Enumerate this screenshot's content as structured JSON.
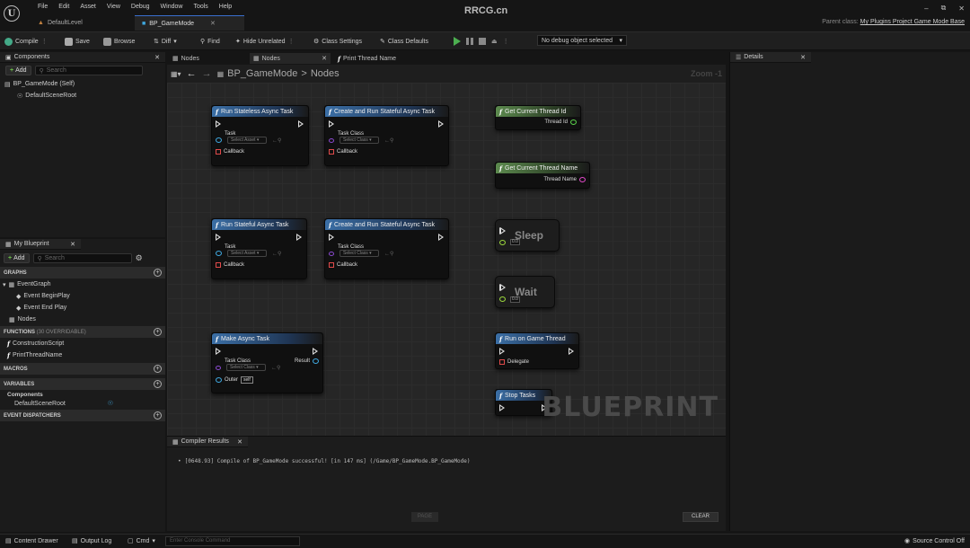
{
  "site_watermark": "RRCG.cn",
  "menu": [
    "File",
    "Edit",
    "Asset",
    "View",
    "Debug",
    "Window",
    "Tools",
    "Help"
  ],
  "tabs": [
    {
      "label": "DefaultLevel",
      "active": false
    },
    {
      "label": "BP_GameMode",
      "active": true
    }
  ],
  "parent_class": {
    "label": "Parent class:",
    "value": "My Plugins Project Game Mode Base"
  },
  "toolbar": {
    "compile": "Compile",
    "save": "Save",
    "browse": "Browse",
    "diff": "Diff",
    "find": "Find",
    "hide_unrelated": "Hide Unrelated",
    "class_settings": "Class Settings",
    "class_defaults": "Class Defaults",
    "debug_object": "No debug object selected"
  },
  "components_panel": {
    "title": "Components",
    "add": "Add",
    "search_placeholder": "Search",
    "root": "BP_GameMode (Self)",
    "child": "DefaultSceneRoot"
  },
  "my_blueprint": {
    "title": "My Blueprint",
    "add": "Add",
    "search_placeholder": "Search",
    "graphs_label": "GRAPHS",
    "event_graph": "EventGraph",
    "begin_play": "Event BeginPlay",
    "end_play": "Event End Play",
    "nodes_graph": "Nodes",
    "functions_label": "FUNCTIONS",
    "functions_overridable": "(30 OVERRIDABLE)",
    "construction_script": "ConstructionScript",
    "print_thread_name": "PrintThreadName",
    "macros_label": "MACROS",
    "variables_label": "VARIABLES",
    "components_group": "Components",
    "default_scene_root": "DefaultSceneRoot",
    "event_dispatchers_label": "EVENT DISPATCHERS"
  },
  "graph_tabs": {
    "tab1": "Nodes",
    "tab2": "Nodes",
    "tab3": "Print Thread Name"
  },
  "breadcrumb": {
    "root": "BP_GameMode",
    "sep": ">",
    "current": "Nodes",
    "zoom": "Zoom -1"
  },
  "nodes": {
    "run_stateless": {
      "title": "Run Stateless Async Task",
      "pin": "Task",
      "select": "Select Asset",
      "callback": "Callback"
    },
    "create_run_stateful_1": {
      "title": "Create and Run Stateful Async Task",
      "pin": "Task Class",
      "select": "Select Class",
      "callback": "Callback"
    },
    "run_stateful": {
      "title": "Run Stateful Async Task",
      "pin": "Task",
      "select": "Select Asset",
      "callback": "Callback"
    },
    "create_run_stateful_2": {
      "title": "Create and Run Stateful Async Task",
      "pin": "Task Class",
      "select": "Select Class",
      "callback": "Callback"
    },
    "make_async": {
      "title": "Make Async Task",
      "pin": "Task Class",
      "select": "Select Class",
      "result": "Result",
      "outer": "Outer",
      "self": "self"
    },
    "get_thread_id": {
      "title": "Get Current Thread Id",
      "out": "Thread Id"
    },
    "get_thread_name": {
      "title": "Get Current Thread Name",
      "out": "Thread Name"
    },
    "sleep": {
      "title": "Sleep",
      "value": "0.0"
    },
    "wait": {
      "title": "Wait",
      "value": "0.0"
    },
    "run_on_game_thread": {
      "title": "Run on Game Thread",
      "delegate": "Delegate"
    },
    "stop_tasks": {
      "title": "Stop Tasks"
    }
  },
  "blueprint_watermark": "BLUEPRINT",
  "details": {
    "title": "Details"
  },
  "compiler": {
    "title": "Compiler Results",
    "message": "[0648.93] Compile of BP_GameMode successful! [in 147 ms] (/Game/BP_GameMode.BP_GameMode)",
    "page": "PAGE",
    "clear": "CLEAR"
  },
  "statusbar": {
    "content_drawer": "Content Drawer",
    "output_log": "Output Log",
    "cmd": "Cmd",
    "console_placeholder": "Enter Console Command",
    "source_control": "Source Control Off"
  },
  "colors": {
    "accent": "#3a6fd0",
    "exec_green": "#4caf50",
    "node_blue": "#3b6fa6",
    "node_green": "#5c8a4e"
  }
}
